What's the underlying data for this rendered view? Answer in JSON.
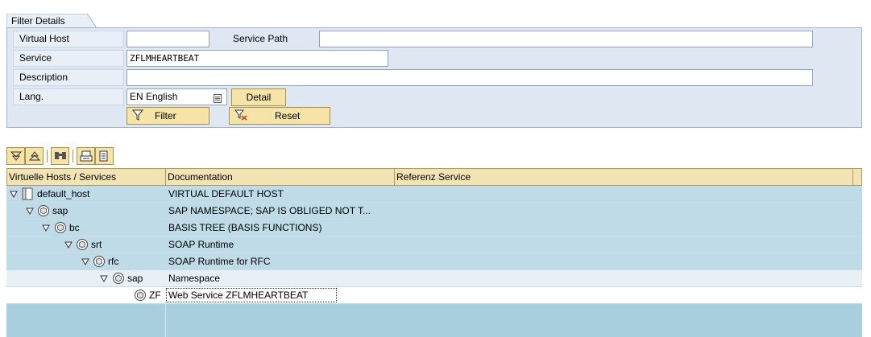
{
  "filter": {
    "tab_title": "Filter Details",
    "virtual_host": {
      "label": "Virtual Host",
      "value": ""
    },
    "service_path": {
      "label": "Service Path",
      "value": ""
    },
    "service": {
      "label": "Service",
      "value": "ZFLMHEARTBEAT"
    },
    "description": {
      "label": "Description",
      "value": ""
    },
    "lang": {
      "label": "Lang.",
      "value": "EN English"
    },
    "detail_button": "Detail",
    "filter_button": "Filter",
    "reset_button": "Reset"
  },
  "toolbar": {
    "icons": [
      "expand-all-icon",
      "collapse-all-icon",
      "find-icon",
      "print-icon",
      "menu-icon"
    ]
  },
  "table": {
    "columns": [
      "Virtuelle Hosts / Services",
      "Documentation",
      "Referenz Service"
    ],
    "rows": [
      {
        "name": "default_host",
        "doc": "VIRTUAL DEFAULT HOST",
        "icon": "host-icon"
      },
      {
        "name": "sap",
        "doc": "SAP NAMESPACE; SAP IS OBLIGED NOT T...",
        "icon": "package-icon"
      },
      {
        "name": "bc",
        "doc": "BASIS TREE (BASIS FUNCTIONS)",
        "icon": "package-icon"
      },
      {
        "name": "srt",
        "doc": "SOAP Runtime",
        "icon": "package-icon"
      },
      {
        "name": "rfc",
        "doc": "SOAP Runtime for RFC",
        "icon": "package-icon"
      },
      {
        "name": "sap",
        "doc": "Namespace",
        "icon": "package-icon"
      },
      {
        "name": "ZF",
        "doc": "Web Service ZFLMHEARTBEAT",
        "icon": "service-icon"
      }
    ]
  },
  "colors": {
    "panel_bg": "#dfe8f2",
    "button_bg": "#f5e3a8",
    "tree_bg": "#a9cfde",
    "header_bg": "#f2e3b4"
  }
}
